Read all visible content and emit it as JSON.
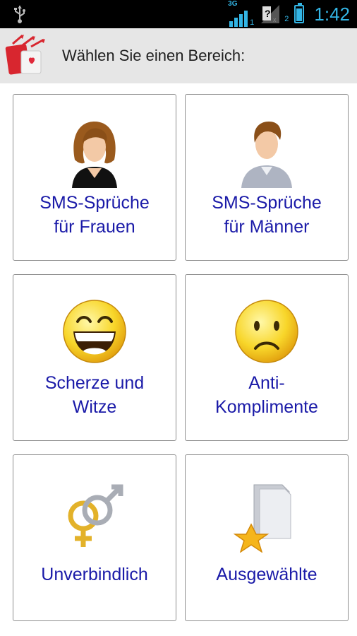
{
  "statusbar": {
    "network_label": "3G",
    "sim1_sub": "1",
    "sim2_sub": "2",
    "time": "1:42"
  },
  "header": {
    "title": "Wählen Sie einen Bereich:"
  },
  "tiles": [
    {
      "label": "SMS-Sprüche\nfür Frauen",
      "icon": "woman-avatar-icon"
    },
    {
      "label": "SMS-Sprüche\nfür Männer",
      "icon": "man-avatar-icon"
    },
    {
      "label": "Scherze und\nWitze",
      "icon": "laughing-smiley-icon"
    },
    {
      "label": "Anti-\nKomplimente",
      "icon": "sad-smiley-icon"
    },
    {
      "label": "Unverbindlich",
      "icon": "gender-symbols-icon"
    },
    {
      "label": "Ausgewählte",
      "icon": "star-folder-icon"
    }
  ],
  "colors": {
    "status_accent": "#33b5e5",
    "header_bg": "#e6e6e6",
    "tile_label": "#1a1aa8",
    "tile_border": "#8e8e8e"
  }
}
